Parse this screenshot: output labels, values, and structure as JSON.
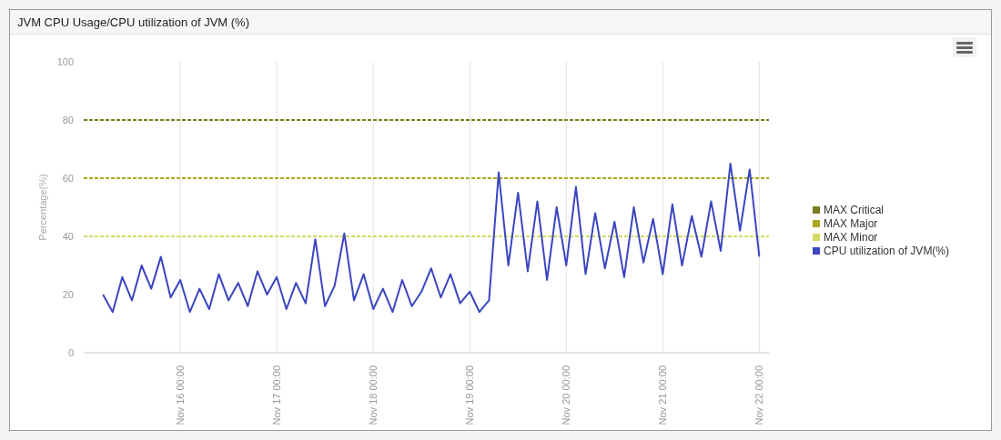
{
  "panel": {
    "title": "JVM CPU Usage/CPU utilization of JVM (%)",
    "chart_data": {
      "type": "line",
      "ylabel": "Percentage(%)",
      "ylim": [
        0,
        100
      ],
      "grid": true,
      "legend": "right",
      "yticks": [
        0,
        20,
        40,
        60,
        80,
        100
      ],
      "categories": [
        null,
        null,
        null,
        null,
        null,
        null,
        null,
        null,
        null,
        null,
        "Nov 16 00:00",
        null,
        null,
        null,
        null,
        null,
        null,
        null,
        null,
        null,
        "Nov 17 00:00",
        null,
        null,
        null,
        null,
        null,
        null,
        null,
        null,
        null,
        "Nov 18 00:00",
        null,
        null,
        null,
        null,
        null,
        null,
        null,
        null,
        null,
        "Nov 19 00:00",
        null,
        null,
        null,
        null,
        null,
        null,
        null,
        null,
        null,
        "Nov 20 00:00",
        null,
        null,
        null,
        null,
        null,
        null,
        null,
        null,
        null,
        "Nov 21 00:00",
        null,
        null,
        null,
        null,
        null,
        null,
        null,
        null,
        null,
        "Nov 22 00:00",
        null
      ],
      "series": [
        {
          "name": "MAX Critical",
          "color": "#7b7d1f",
          "line_style": "dashed",
          "values": [
            80,
            80,
            80,
            80,
            80,
            80,
            80,
            80,
            80,
            80,
            80,
            80,
            80,
            80,
            80,
            80,
            80,
            80,
            80,
            80,
            80,
            80,
            80,
            80,
            80,
            80,
            80,
            80,
            80,
            80,
            80,
            80,
            80,
            80,
            80,
            80,
            80,
            80,
            80,
            80,
            80,
            80,
            80,
            80,
            80,
            80,
            80,
            80,
            80,
            80,
            80,
            80,
            80,
            80,
            80,
            80,
            80,
            80,
            80,
            80,
            80,
            80,
            80,
            80,
            80,
            80,
            80,
            80,
            80,
            80,
            80,
            80
          ]
        },
        {
          "name": "MAX Major",
          "color": "#a8aa22",
          "line_style": "dashed",
          "values": [
            60,
            60,
            60,
            60,
            60,
            60,
            60,
            60,
            60,
            60,
            60,
            60,
            60,
            60,
            60,
            60,
            60,
            60,
            60,
            60,
            60,
            60,
            60,
            60,
            60,
            60,
            60,
            60,
            60,
            60,
            60,
            60,
            60,
            60,
            60,
            60,
            60,
            60,
            60,
            60,
            60,
            60,
            60,
            60,
            60,
            60,
            60,
            60,
            60,
            60,
            60,
            60,
            60,
            60,
            60,
            60,
            60,
            60,
            60,
            60,
            60,
            60,
            60,
            60,
            60,
            60,
            60,
            60,
            60,
            60,
            60,
            60
          ]
        },
        {
          "name": "MAX Minor",
          "color": "#d5d964",
          "line_style": "dashed",
          "values": [
            40,
            40,
            40,
            40,
            40,
            40,
            40,
            40,
            40,
            40,
            40,
            40,
            40,
            40,
            40,
            40,
            40,
            40,
            40,
            40,
            40,
            40,
            40,
            40,
            40,
            40,
            40,
            40,
            40,
            40,
            40,
            40,
            40,
            40,
            40,
            40,
            40,
            40,
            40,
            40,
            40,
            40,
            40,
            40,
            40,
            40,
            40,
            40,
            40,
            40,
            40,
            40,
            40,
            40,
            40,
            40,
            40,
            40,
            40,
            40,
            40,
            40,
            40,
            40,
            40,
            40,
            40,
            40,
            40,
            40,
            40,
            40
          ]
        },
        {
          "name": "CPU utilization of JVM(%)",
          "color": "#3a45c0",
          "line_style": "solid",
          "values": [
            null,
            null,
            20,
            14,
            26,
            18,
            30,
            22,
            33,
            19,
            25,
            14,
            22,
            15,
            27,
            18,
            24,
            16,
            28,
            20,
            26,
            15,
            24,
            17,
            39,
            16,
            23,
            41,
            18,
            27,
            15,
            22,
            14,
            25,
            16,
            21,
            29,
            19,
            27,
            17,
            21,
            14,
            18,
            62,
            30,
            55,
            28,
            52,
            25,
            50,
            30,
            57,
            27,
            48,
            29,
            45,
            26,
            50,
            31,
            46,
            27,
            51,
            30,
            47,
            33,
            52,
            35,
            65,
            42,
            63,
            33,
            null
          ]
        }
      ]
    }
  }
}
